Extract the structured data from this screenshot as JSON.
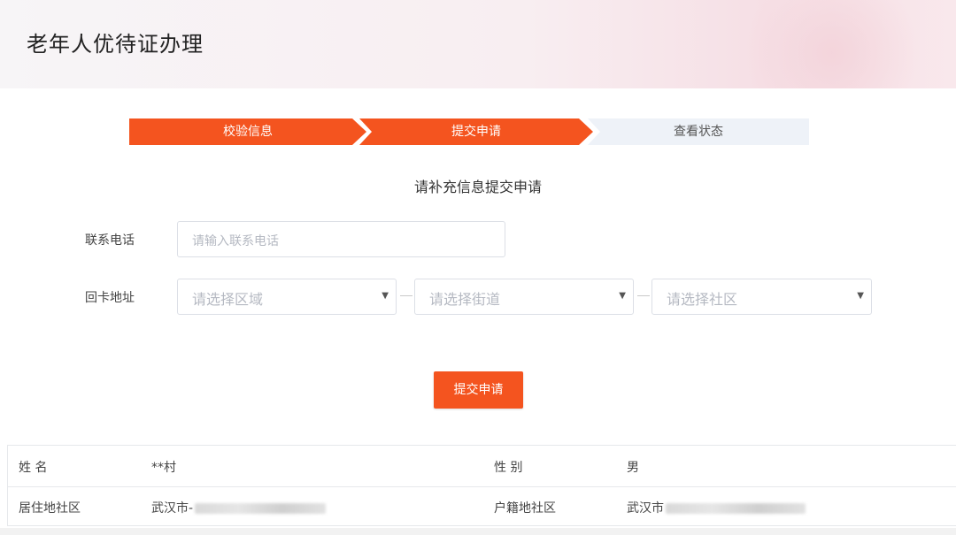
{
  "header": {
    "title": "老年人优待证办理"
  },
  "steps": [
    {
      "label": "校验信息"
    },
    {
      "label": "提交申请"
    },
    {
      "label": "查看状态"
    }
  ],
  "form": {
    "subtitle": "请补充信息提交申请",
    "phone_label": "联系电话",
    "phone_placeholder": "请输入联系电话",
    "address_label": "回卡地址",
    "district_placeholder": "请选择区域",
    "street_placeholder": "请选择街道",
    "community_placeholder": "请选择社区",
    "submit_label": "提交申请"
  },
  "info": {
    "name_label": "姓 名",
    "name_value": "**村",
    "gender_label": "性 别",
    "gender_value": "男",
    "residence_label": "居住地社区",
    "residence_value": "武汉市-",
    "household_label": "户籍地社区",
    "household_value": "武汉市"
  },
  "colors": {
    "accent": "#f4541f",
    "inactive_step": "#eef2f8"
  }
}
